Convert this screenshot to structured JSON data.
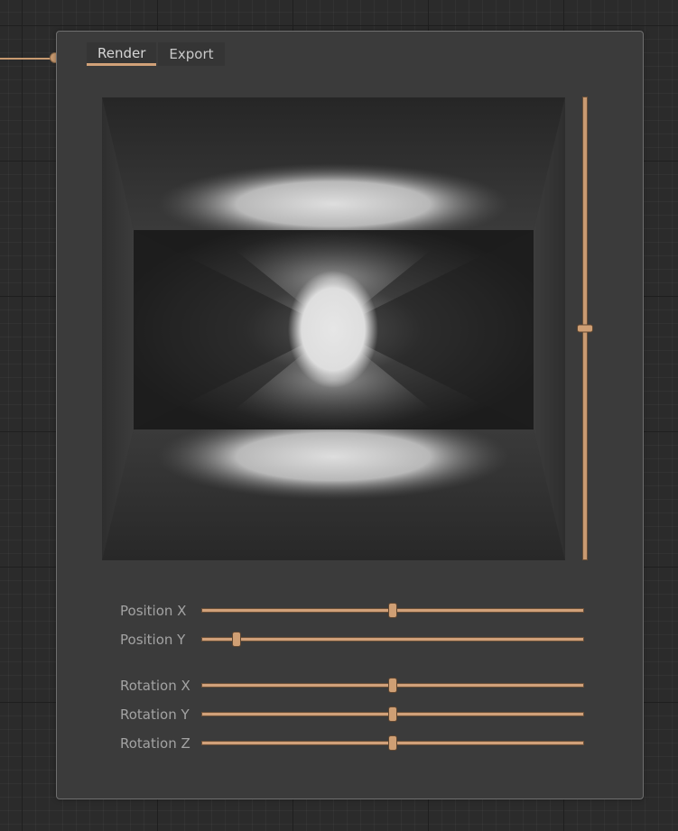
{
  "tabs": [
    {
      "label": "Render",
      "active": true
    },
    {
      "label": "Export",
      "active": false
    }
  ],
  "vertical_slider": {
    "value": 0.5
  },
  "parameters": [
    {
      "label": "Position X",
      "value": 0.5
    },
    {
      "label": "Position Y",
      "value": 0.09
    },
    {
      "label": "Rotation X",
      "value": 0.5
    },
    {
      "label": "Rotation Y",
      "value": 0.5
    },
    {
      "label": "Rotation Z",
      "value": 0.5
    }
  ],
  "colors": {
    "accent": "#d1a17a",
    "background": "#2b2b2b",
    "panel": "#3b3b3b",
    "label": "#a3a3a3"
  }
}
